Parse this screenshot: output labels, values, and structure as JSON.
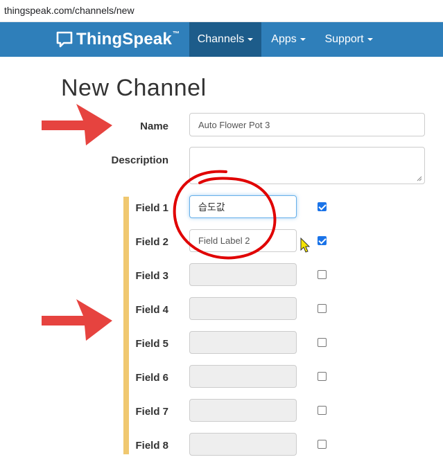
{
  "browser": {
    "url": "thingspeak.com/channels/new"
  },
  "navbar": {
    "brand": "ThingSpeak",
    "trademark": "™",
    "items": [
      {
        "label": "Channels",
        "active": true
      },
      {
        "label": "Apps",
        "active": false
      },
      {
        "label": "Support",
        "active": false
      }
    ]
  },
  "page": {
    "title": "New Channel"
  },
  "form": {
    "name_label": "Name",
    "name_value": "Auto Flower Pot 3",
    "description_label": "Description",
    "description_value": "",
    "fields": [
      {
        "label": "Field 1",
        "value": "습도값",
        "checked": true
      },
      {
        "label": "Field 2",
        "value": "Field Label 2",
        "checked": true
      },
      {
        "label": "Field 3",
        "value": "",
        "checked": false
      },
      {
        "label": "Field 4",
        "value": "",
        "checked": false
      },
      {
        "label": "Field 5",
        "value": "",
        "checked": false
      },
      {
        "label": "Field 6",
        "value": "",
        "checked": false
      },
      {
        "label": "Field 7",
        "value": "",
        "checked": false
      },
      {
        "label": "Field 8",
        "value": "",
        "checked": false
      }
    ]
  },
  "colors": {
    "navbar": "#2f7fba",
    "navbar_active": "#1d5c8a",
    "annotation_arrow": "#e53935",
    "annotation_circle": "#e00000",
    "field_bar": "#f0c870",
    "checkbox_checked": "#1a73e8"
  }
}
